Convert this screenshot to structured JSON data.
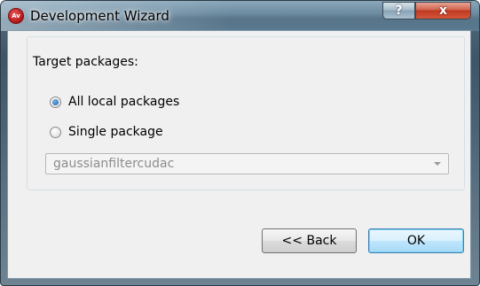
{
  "window": {
    "title": "Development Wizard",
    "app_icon_text": "Av",
    "help_label": "?",
    "close_label": "x"
  },
  "group": {
    "title": "Target packages:"
  },
  "options": {
    "all_local": {
      "label": "All local packages",
      "checked": true
    },
    "single": {
      "label": "Single package",
      "checked": false
    }
  },
  "combo": {
    "value": "gaussianfiltercudac",
    "enabled": false
  },
  "buttons": {
    "back_label": "<< Back",
    "ok_label": "OK"
  },
  "colors": {
    "accent": "#3c7fb1",
    "titlebar": "#6e8da2",
    "close": "#c0391f"
  }
}
